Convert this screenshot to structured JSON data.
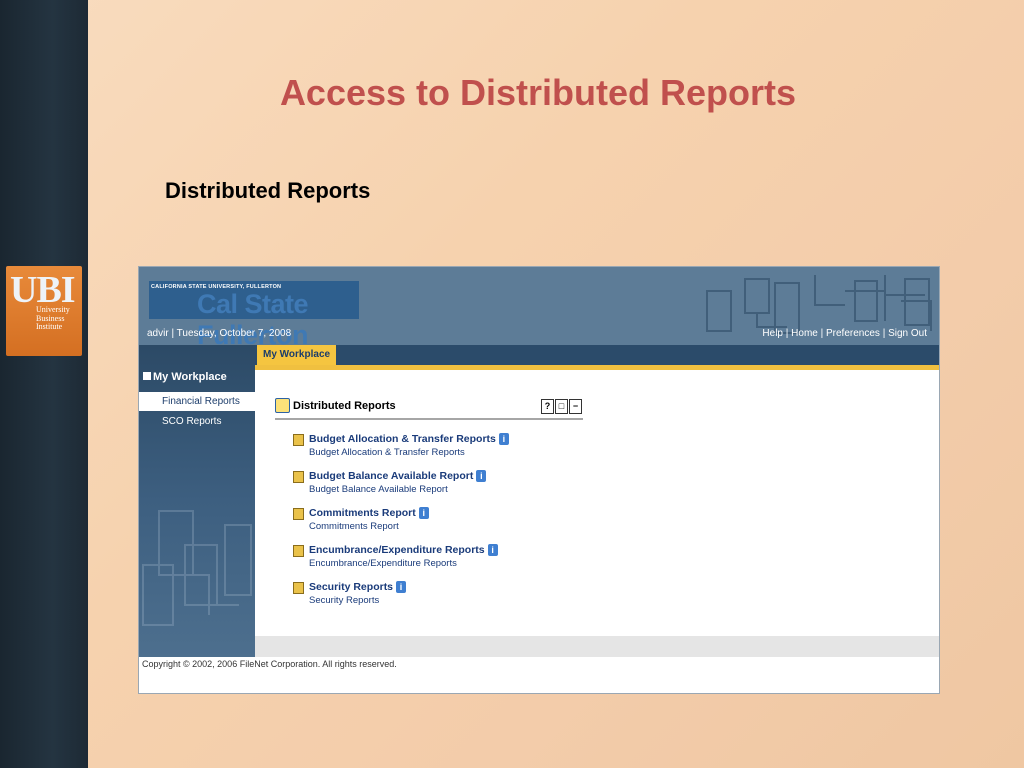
{
  "slide": {
    "title": "Access to Distributed Reports",
    "subtitle": "Distributed Reports",
    "logo": {
      "big": "UBI",
      "line1": "University",
      "line2": "Business",
      "line3": "Institute"
    }
  },
  "portal": {
    "university": "CALIFORNIA STATE UNIVERSITY, FULLERTON",
    "banner": "Cal State Fullerton",
    "user_line": "advir | Tuesday, October 7, 2008",
    "top_links": {
      "help": "Help",
      "home": "Home",
      "preferences": "Preferences",
      "sign_out": "Sign Out",
      "sep": " | "
    },
    "tab": "My Workplace",
    "nav": {
      "title": "My Workplace",
      "items": [
        {
          "label": "Financial Reports"
        },
        {
          "label": "SCO Reports"
        }
      ]
    },
    "portlet": {
      "title": "Distributed Reports",
      "controls": [
        "?",
        "□",
        "−"
      ],
      "reports": [
        {
          "label": "Budget Allocation & Transfer Reports",
          "desc": "Budget Allocation & Transfer Reports"
        },
        {
          "label": "Budget Balance Available Report",
          "desc": "Budget Balance Available Report"
        },
        {
          "label": "Commitments Report",
          "desc": "Commitments Report"
        },
        {
          "label": "Encumbrance/Expenditure Reports",
          "desc": "Encumbrance/Expenditure Reports"
        },
        {
          "label": "Security Reports",
          "desc": "Security Reports"
        }
      ]
    },
    "footer": "Copyright © 2002, 2006 FileNet Corporation. All rights reserved."
  }
}
